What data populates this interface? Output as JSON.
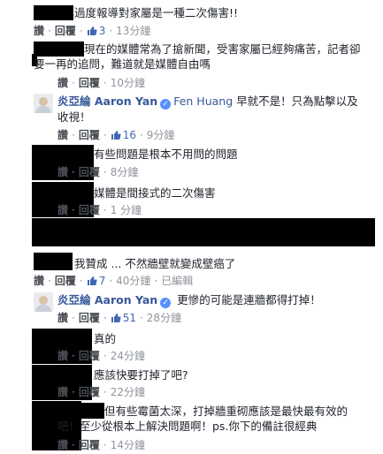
{
  "comments": [
    {
      "text": "過度報導對家屬是一種二次傷害!!",
      "actions": {
        "reply_to": "讚",
        "reply": "回覆",
        "likes": "3",
        "time": "13分鐘"
      }
    },
    {
      "text": "現在的媒體常為了搶新聞，受害家屬已經夠痛苦，記者卻要一再的追問，難道就是媒體自由嗎",
      "actions": {
        "reply_to": "讚",
        "reply": "回覆",
        "time": "10分鐘"
      }
    },
    {
      "author": "炎亞綸 Aaron Yan",
      "mention": "Fen Huang",
      "text": "早就不是！只為點擊以及收視！",
      "actions": {
        "reply_to": "讚",
        "reply": "回覆",
        "likes": "16",
        "time": "9分鐘"
      }
    },
    {
      "text": "有些問題是根本不用問的問題",
      "actions": {
        "reply_to": "讚",
        "reply": "回覆",
        "time": "8分鐘"
      }
    },
    {
      "text": "媒體是間接式的二次傷害",
      "actions": {
        "reply_to": "讚",
        "reply": "回覆",
        "time": "1 分鐘"
      }
    },
    {
      "text": "我贊成 ... 不然牆壁就變成壁癌了",
      "actions": {
        "reply_to": "讚",
        "reply": "回覆",
        "likes": "7",
        "time": "40分鐘",
        "edited": "已編輯"
      }
    },
    {
      "author": "炎亞綸 Aaron Yan",
      "text": "更慘的可能是連牆都得打掉！",
      "actions": {
        "reply_to": "讚",
        "reply": "回覆",
        "likes": "51",
        "time": "28分鐘"
      }
    },
    {
      "text": "真的",
      "actions": {
        "reply_to": "讚",
        "reply": "回覆",
        "time": "24分鐘"
      }
    },
    {
      "text": "應該快要打掉了吧?",
      "actions": {
        "reply_to": "讚",
        "reply": "回覆",
        "time": "22分鐘"
      }
    },
    {
      "text": "但有些霉菌太深，打掉牆重砌應該是最快最有效的吧！至少從根本上解決問題啊！ps.你下的備註很經典",
      "actions": {
        "reply_to": "讚",
        "reply": "回覆",
        "time": "14分鐘"
      }
    }
  ],
  "dot": "·",
  "icons": {
    "like": "thumbs-up-icon",
    "verified": "verified-badge-icon",
    "avatar": "profile-avatar"
  },
  "colors": {
    "link": "#4b4f56",
    "name": "#365899",
    "like": "#4267b2",
    "meta": "#90949c",
    "redaction": "#000000"
  }
}
